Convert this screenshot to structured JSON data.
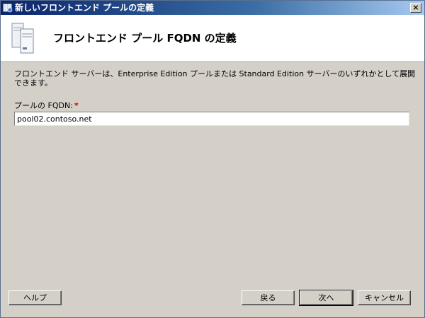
{
  "window": {
    "title": "新しいフロントエンド プールの定義",
    "close_glyph": "×"
  },
  "header": {
    "title": "フロントエンド プール FQDN の定義",
    "icon": "server-stack-icon"
  },
  "main": {
    "description": "フロントエンド サーバーは、Enterprise Edition プールまたは Standard Edition サーバーのいずれかとして展開できます。",
    "fqdn_label": "プールの FQDN:",
    "required_marker": "*",
    "fqdn_value": "pool02.contoso.net"
  },
  "buttons": {
    "help": "ヘルプ",
    "back": "戻る",
    "next": "次へ",
    "cancel": "キャンセル"
  },
  "colors": {
    "titlebar_start": "#0a246a",
    "titlebar_end": "#a6caf0",
    "dialog_bg": "#d4d0c8",
    "required": "#cc0000"
  }
}
